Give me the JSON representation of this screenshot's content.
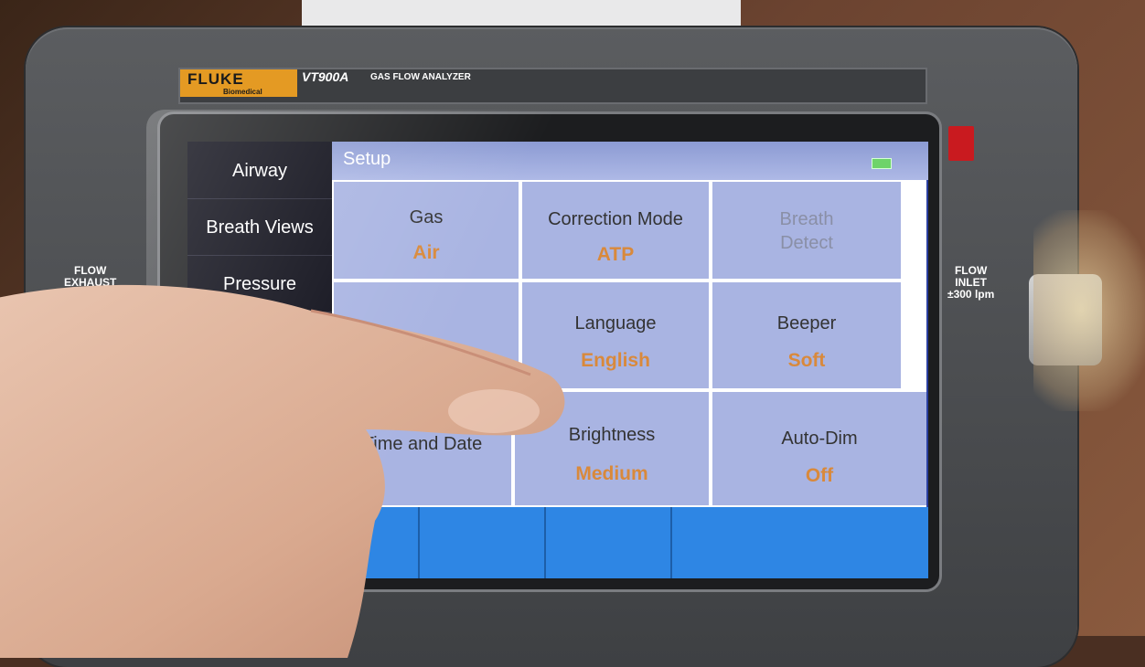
{
  "device": {
    "brand": "FLUKE",
    "brand_sub": "Biomedical",
    "model": "VT900A",
    "model_sub": "GAS FLOW ANALYZER",
    "left_port_label": "FLOW\nEXHAUST",
    "right_port_label": "FLOW\nINLET\n±300 lpm"
  },
  "screen": {
    "title": "Setup",
    "nav": [
      "Airway",
      "Breath Views",
      "Pressure"
    ],
    "cells": [
      {
        "label": "Gas",
        "value": "Air"
      },
      {
        "label": "Correction Mode",
        "value": "ATP"
      },
      {
        "label": "Breath\nDetect",
        "value": ""
      },
      {
        "label": "",
        "value": ""
      },
      {
        "label": "Language",
        "value": "English"
      },
      {
        "label": "Beeper",
        "value": "Soft"
      },
      {
        "label": "Time and Date",
        "value": ""
      },
      {
        "label": "Brightness",
        "value": "Medium"
      },
      {
        "label": "Auto-Dim",
        "value": "Off"
      }
    ]
  },
  "colors": {
    "brand_orange": "#e49a23",
    "cell_bg": "#a9b4e2",
    "value_orange": "#d9893b",
    "softkey_blue": "#2e86e4"
  }
}
